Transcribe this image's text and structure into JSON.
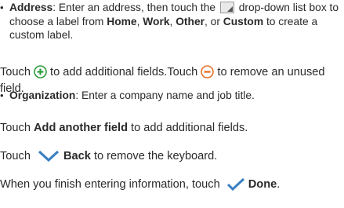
{
  "address": {
    "bullet": "•",
    "label": "Address",
    "t1": ": Enter an address, then touch the ",
    "t2": " drop-down list box to choose a label from ",
    "home": "Home",
    "sep1": ", ",
    "work": "Work",
    "sep2": ", ",
    "other": "Other",
    "sep3": ", or ",
    "custom": "Custom",
    "t3": " to create a custom label."
  },
  "organization": {
    "bullet": "•",
    "label": "Organization",
    "text": ": Enter a company name and job title."
  },
  "touch_add_remove": {
    "touch1": "Touch ",
    "add_text": " to add additional fields.Touch ",
    "remove_text": " to remove an unused field."
  },
  "add_another": {
    "touch": "Touch ",
    "label": "Add another field",
    "text": " to add additional fields."
  },
  "back": {
    "touch": "Touch ",
    "label": "Back",
    "text": " to remove the keyboard."
  },
  "done": {
    "text": "When you finish entering information, touch ",
    "label": "Done",
    "end": "."
  },
  "colors": {
    "plus": "#2e9e3e",
    "minus": "#e8722a",
    "icon_blue": "#3a7fc1"
  }
}
